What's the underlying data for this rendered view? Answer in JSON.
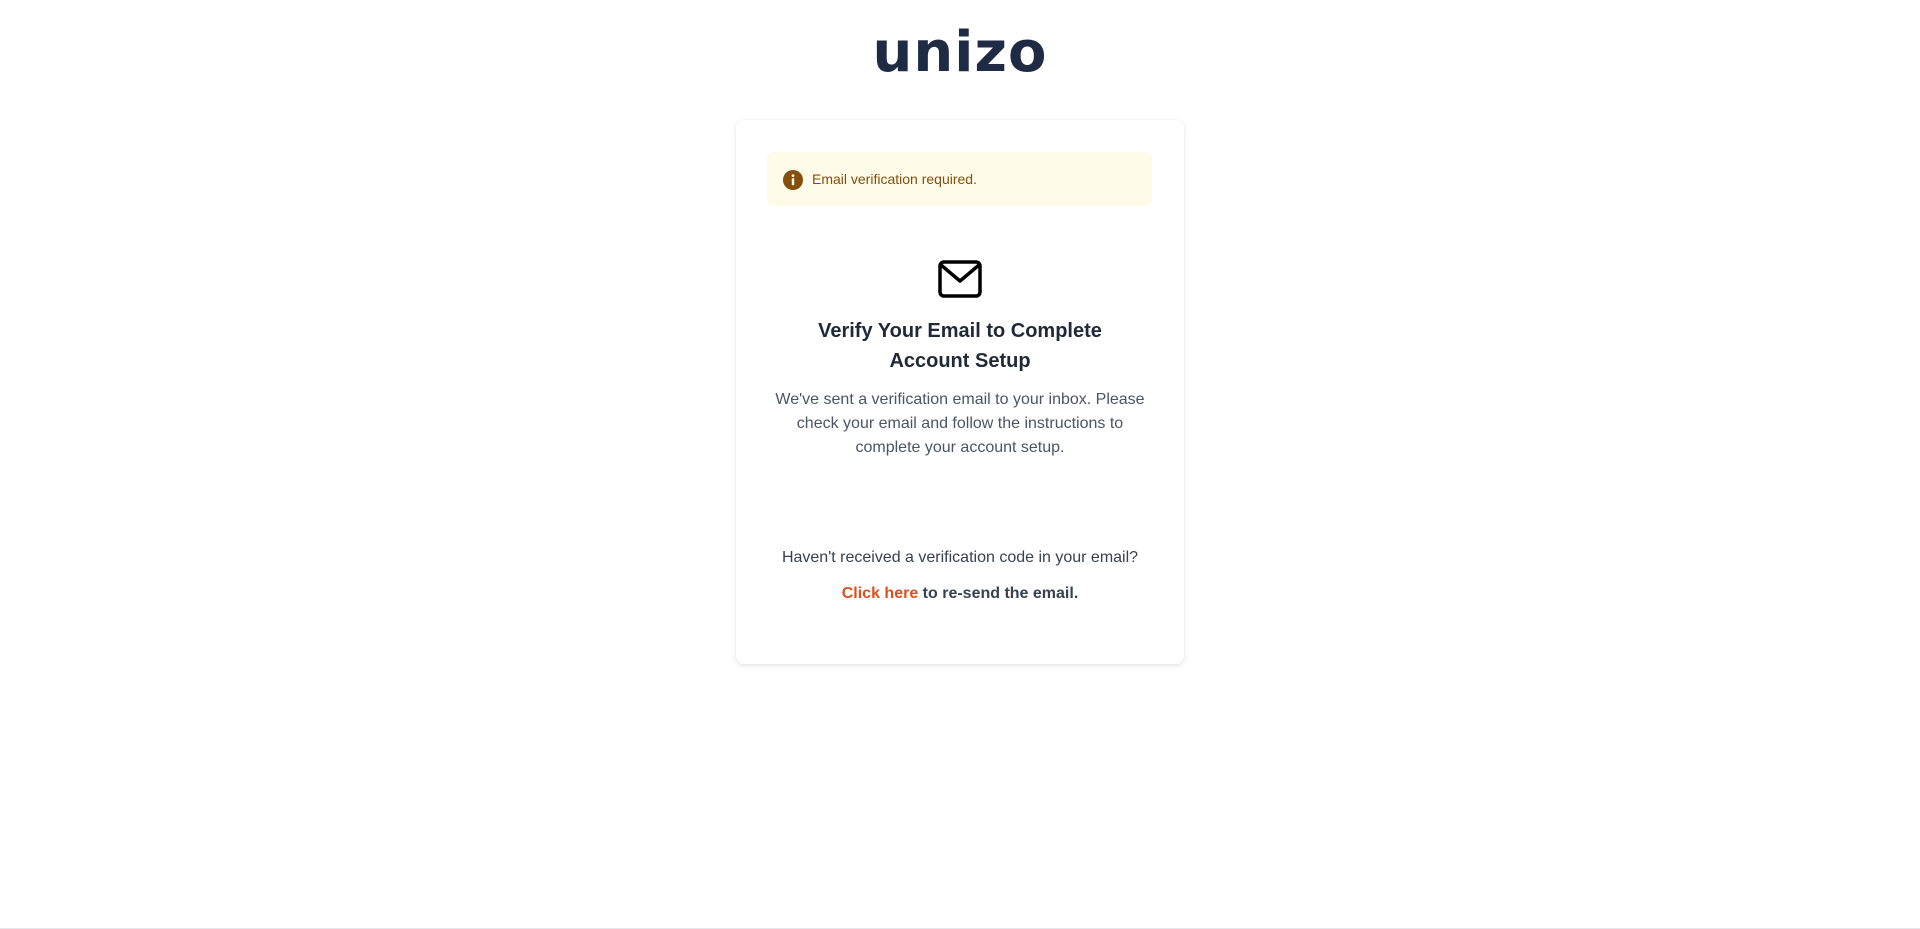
{
  "brand": {
    "logo_text": "unizo",
    "color": "#1f2a44"
  },
  "alert": {
    "icon": "info-icon",
    "message": "Email verification required.",
    "background": "#fefce8",
    "text_color": "#854d0e"
  },
  "verify": {
    "icon": "mail-icon",
    "title": "Verify Your Email to Complete Account Setup",
    "description": "We've sent a verification email to your inbox. Please check your email and follow the instructions to complete your account setup."
  },
  "resend": {
    "prompt": "Haven't received a verification code in your email?",
    "link_label": "Click here",
    "suffix": " to re-send the email.",
    "link_color": "#e24d1c"
  }
}
